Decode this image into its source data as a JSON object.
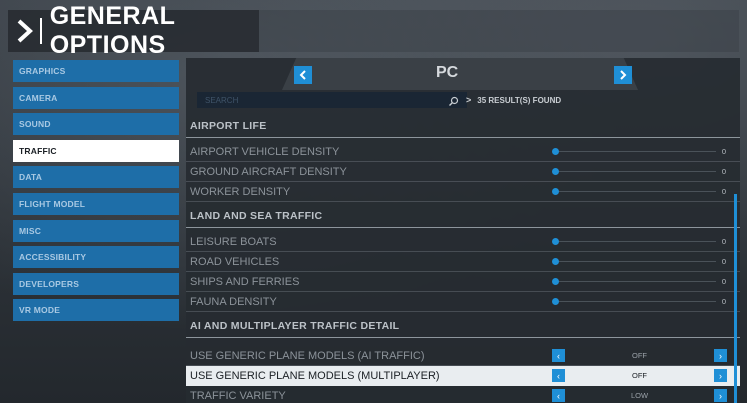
{
  "page_title": "GENERAL OPTIONS",
  "sidebar": {
    "items": [
      {
        "label": "GRAPHICS"
      },
      {
        "label": "CAMERA"
      },
      {
        "label": "SOUND"
      },
      {
        "label": "TRAFFIC"
      },
      {
        "label": "DATA"
      },
      {
        "label": "FLIGHT MODEL"
      },
      {
        "label": "MISC"
      },
      {
        "label": "ACCESSIBILITY"
      },
      {
        "label": "DEVELOPERS"
      },
      {
        "label": "VR MODE"
      }
    ],
    "active": "TRAFFIC"
  },
  "platform_nav": {
    "prev_icon": "chevron-left-icon",
    "label": "PC",
    "next_icon": "chevron-right-icon"
  },
  "search": {
    "placeholder": "SEARCH",
    "results_text": "35 RESULT(S) FOUND"
  },
  "sections": {
    "airport_life": {
      "title": "AIRPORT LIFE",
      "rows": [
        {
          "label": "AIRPORT VEHICLE DENSITY",
          "value": "0"
        },
        {
          "label": "GROUND AIRCRAFT DENSITY",
          "value": "0"
        },
        {
          "label": "WORKER DENSITY",
          "value": "0"
        }
      ]
    },
    "land_sea": {
      "title": "LAND AND SEA TRAFFIC",
      "rows": [
        {
          "label": "LEISURE BOATS",
          "value": "0"
        },
        {
          "label": "ROAD VEHICLES",
          "value": "0"
        },
        {
          "label": "SHIPS AND FERRIES",
          "value": "0"
        },
        {
          "label": "FAUNA DENSITY",
          "value": "0"
        }
      ]
    },
    "ai_multi": {
      "title": "AI AND MULTIPLAYER TRAFFIC DETAIL",
      "rows": [
        {
          "label": "USE GENERIC PLANE MODELS (AI TRAFFIC)",
          "value": "OFF"
        },
        {
          "label": "USE GENERIC PLANE MODELS (MULTIPLAYER)",
          "value": "OFF"
        },
        {
          "label": "TRAFFIC VARIETY",
          "value": "LOW"
        }
      ]
    }
  },
  "colors": {
    "accent": "#1f8fd6",
    "sidebar_item": "#1e6ea8",
    "active_item": "#ffffff"
  }
}
